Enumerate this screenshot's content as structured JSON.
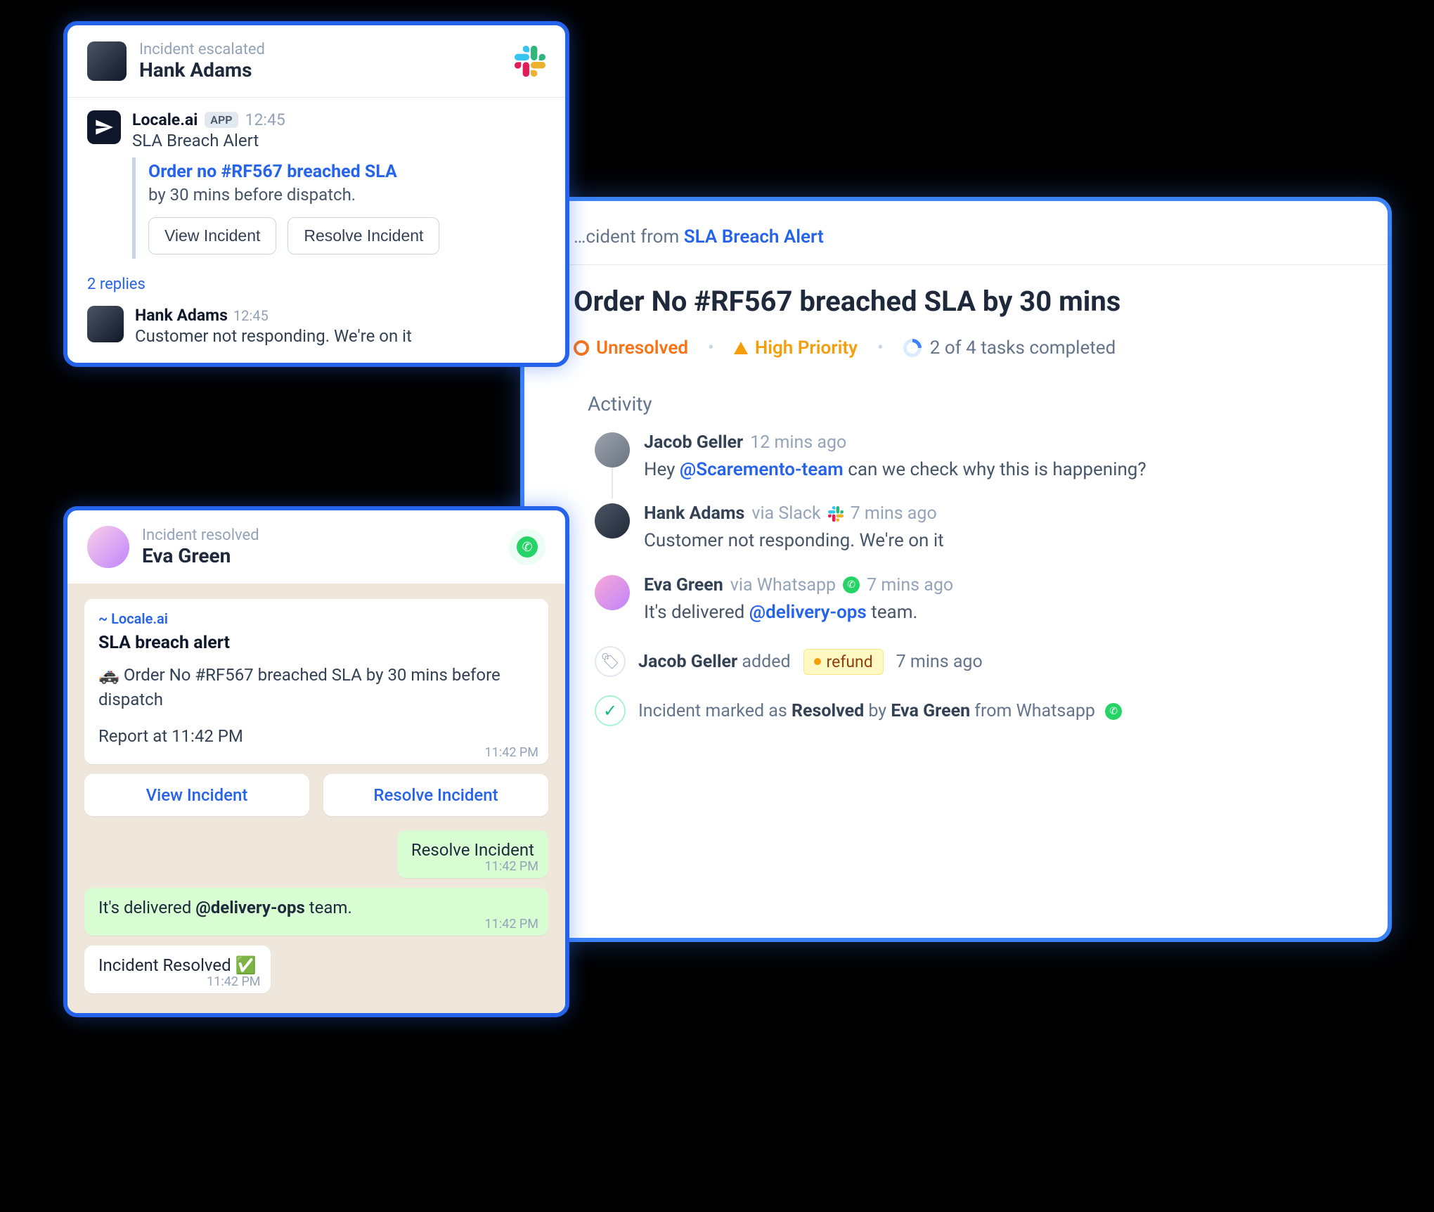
{
  "slack_card": {
    "subtitle": "Incident escalated",
    "person": "Hank Adams",
    "app_name": "Locale.ai",
    "app_badge": "APP",
    "time": "12:45",
    "alert_type": "SLA Breach Alert",
    "quote_title": "Order no #RF567 breached SLA",
    "quote_sub": "by 30 mins before dispatch.",
    "btn_view": "View Incident",
    "btn_resolve": "Resolve Incident",
    "replies_label": "2 replies",
    "reply": {
      "name": "Hank Adams",
      "time": "12:45",
      "text": "Customer not responding. We're on it"
    }
  },
  "wa_card": {
    "subtitle": "Incident resolved",
    "person": "Eva Green",
    "sender": "~ Locale.ai",
    "alert_title": "SLA breach alert",
    "alert_body": "🚓 Order No #RF567 breached SLA by 30 mins before dispatch",
    "report_line": "Report at 11:42 PM",
    "ts": "11:42 PM",
    "btn_view": "View Incident",
    "btn_resolve": "Resolve Incident",
    "out1": "Resolve Incident",
    "out2_pre": "It's delivered ",
    "out2_mention": "@delivery-ops",
    "out2_post": " team.",
    "sys": "Incident Resolved"
  },
  "right": {
    "crumb_pre": "…cident from ",
    "crumb_link": "SLA Breach Alert",
    "title": "Order No #RF567 breached SLA by 30 mins",
    "status": "Unresolved",
    "priority": "High Priority",
    "tasks": "2 of 4 tasks completed",
    "activity_h": "Activity",
    "a1": {
      "name": "Jacob Geller",
      "time": "12 mins ago",
      "pre": "Hey ",
      "mention": "@Scaremento-team",
      "post": " can we check why this is happening?"
    },
    "a2": {
      "name": "Hank Adams",
      "via": "via Slack",
      "time": "7 mins ago",
      "msg": "Customer not responding. We're on it"
    },
    "a3": {
      "name": "Eva Green",
      "via": "via Whatsapp",
      "time": "7 mins ago",
      "pre": "It's delivered ",
      "mention": "@delivery-ops",
      "post": " team."
    },
    "tag": {
      "name": "Jacob Geller",
      "verb": "added",
      "chip": "refund",
      "time": "7 mins ago"
    },
    "resolved": {
      "pre": "Incident marked as ",
      "state": "Resolved",
      "mid": " by ",
      "who": "Eva Green",
      "post": " from Whatsapp"
    }
  }
}
